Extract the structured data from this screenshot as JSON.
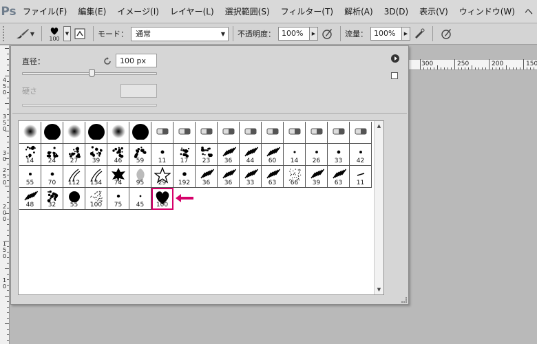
{
  "app_logo": "Ps",
  "menu": [
    "ファイル(F)",
    "編集(E)",
    "イメージ(I)",
    "レイヤー(L)",
    "選択範囲(S)",
    "フィルター(T)",
    "解析(A)",
    "3D(D)",
    "表示(V)",
    "ウィンドウ(W)"
  ],
  "menu_more": "ヘ",
  "options": {
    "brush_size_preview": "100",
    "mode_label": "モード：",
    "mode_value": "通常",
    "opacity_label": "不透明度：",
    "opacity_value": "100%",
    "flow_label": "流量：",
    "flow_value": "100%"
  },
  "ruler_top_labels": [
    "300",
    "250",
    "200",
    "150"
  ],
  "ruler_left_labels": [
    "4",
    "5",
    "0",
    "3",
    "5",
    "0",
    "3",
    "0",
    "2",
    "5",
    "0",
    "2",
    "0",
    "0",
    "1",
    "5",
    "0",
    "1",
    "0"
  ],
  "panel": {
    "size_label": "直径：",
    "size_value": "100 px",
    "size_level": 0.52,
    "hardness_label": "硬さ",
    "hardness_value": ""
  },
  "brushes": [
    {
      "kind": "soft"
    },
    {
      "kind": "hard"
    },
    {
      "kind": "soft"
    },
    {
      "kind": "hard"
    },
    {
      "kind": "soft"
    },
    {
      "kind": "hard"
    },
    {
      "kind": "tool"
    },
    {
      "kind": "tool"
    },
    {
      "kind": "tool"
    },
    {
      "kind": "tool"
    },
    {
      "kind": "tool"
    },
    {
      "kind": "tool"
    },
    {
      "kind": "tool"
    },
    {
      "kind": "tool"
    },
    {
      "kind": "tool"
    },
    {
      "kind": "tool"
    },
    {
      "kind": "splat",
      "num": "14"
    },
    {
      "kind": "splat",
      "num": "24"
    },
    {
      "kind": "splat",
      "num": "27"
    },
    {
      "kind": "splat",
      "num": "39"
    },
    {
      "kind": "splat",
      "num": "46"
    },
    {
      "kind": "splat",
      "num": "59"
    },
    {
      "kind": "dot",
      "num": "11"
    },
    {
      "kind": "splat",
      "num": "17"
    },
    {
      "kind": "splat",
      "num": "23"
    },
    {
      "kind": "hatch",
      "num": "36"
    },
    {
      "kind": "hatch",
      "num": "44"
    },
    {
      "kind": "hatch",
      "num": "60"
    },
    {
      "kind": "dot",
      "num": "14"
    },
    {
      "kind": "dot",
      "num": "26"
    },
    {
      "kind": "dot",
      "num": "33"
    },
    {
      "kind": "dot",
      "num": "42"
    },
    {
      "kind": "dot",
      "num": "55"
    },
    {
      "kind": "dot",
      "num": "70"
    },
    {
      "kind": "grass",
      "num": "112"
    },
    {
      "kind": "grass",
      "num": "134"
    },
    {
      "kind": "leaf",
      "num": "74"
    },
    {
      "kind": "leaf-gray",
      "num": "95"
    },
    {
      "kind": "star",
      "num": "29"
    },
    {
      "kind": "dot",
      "num": "192"
    },
    {
      "kind": "hatch",
      "num": "36"
    },
    {
      "kind": "hatch",
      "num": "36"
    },
    {
      "kind": "hatch",
      "num": "33"
    },
    {
      "kind": "hatch",
      "num": "63"
    },
    {
      "kind": "speckle",
      "num": "66"
    },
    {
      "kind": "hatch",
      "num": "39"
    },
    {
      "kind": "hatch",
      "num": "63"
    },
    {
      "kind": "dash",
      "num": "11"
    },
    {
      "kind": "hatch",
      "num": "48"
    },
    {
      "kind": "splat",
      "num": "32"
    },
    {
      "kind": "round",
      "num": "55"
    },
    {
      "kind": "speckle",
      "num": "100"
    },
    {
      "kind": "dot",
      "num": "75"
    },
    {
      "kind": "dot",
      "num": "45"
    },
    {
      "kind": "heart",
      "num": "100",
      "selected": true
    }
  ],
  "accent_color": "#d6006a"
}
